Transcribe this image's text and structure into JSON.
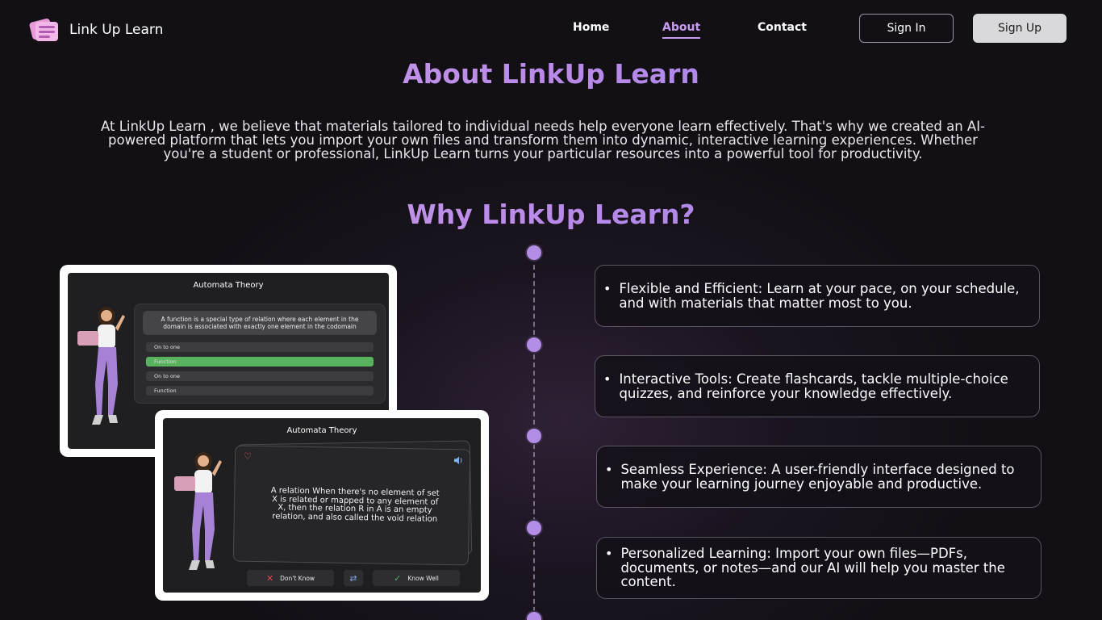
{
  "brand": {
    "name": "Link Up Learn"
  },
  "nav": {
    "links": [
      {
        "label": "Home"
      },
      {
        "label": "About"
      },
      {
        "label": "Contact"
      }
    ],
    "active": "About",
    "sign_in": "Sign In",
    "sign_up": "Sign Up"
  },
  "about": {
    "title": "About LinkUp Learn",
    "body": "At LinkUp Learn , we believe that materials tailored to individual needs help everyone learn effectively. That's why we created an AI-powered platform that lets you import your own files and transform them into dynamic, interactive learning experiences. Whether you're a student or professional, LinkUp Learn turns your particular resources into a powerful tool for productivity."
  },
  "why": {
    "title": "Why LinkUp Learn?",
    "features": [
      {
        "text": "Flexible and Efficient: Learn at your pace, on your schedule, and with materials that matter most to you."
      },
      {
        "text": "Interactive Tools: Create flashcards, tackle multiple-choice quizzes, and reinforce your knowledge effectively."
      },
      {
        "text": "Seamless Experience: A user-friendly interface designed to make your learning journey enjoyable and productive."
      },
      {
        "text": "Personalized Learning: Import your own files—PDFs, documents, or notes—and our AI will help you master the content."
      }
    ]
  },
  "quiz_preview": {
    "title": "Automata Theory",
    "question": "A function is a special type of relation where each element in the domain is associated with exactly one element in the codomain",
    "options": [
      "On to one",
      "Function",
      "On to one",
      "Function"
    ],
    "correct_option": "Function"
  },
  "flashcard_preview": {
    "title": "Automata Theory",
    "text": "A relation When there's no element of set X is related or mapped to any element of X, then the relation R in A is an empty relation, and also called the void relation",
    "dont_know": "Don't Know",
    "know_well": "Know Well"
  },
  "colors": {
    "accent": "#c89bf2",
    "dot": "#b48ee6",
    "correct": "#58b25e"
  }
}
